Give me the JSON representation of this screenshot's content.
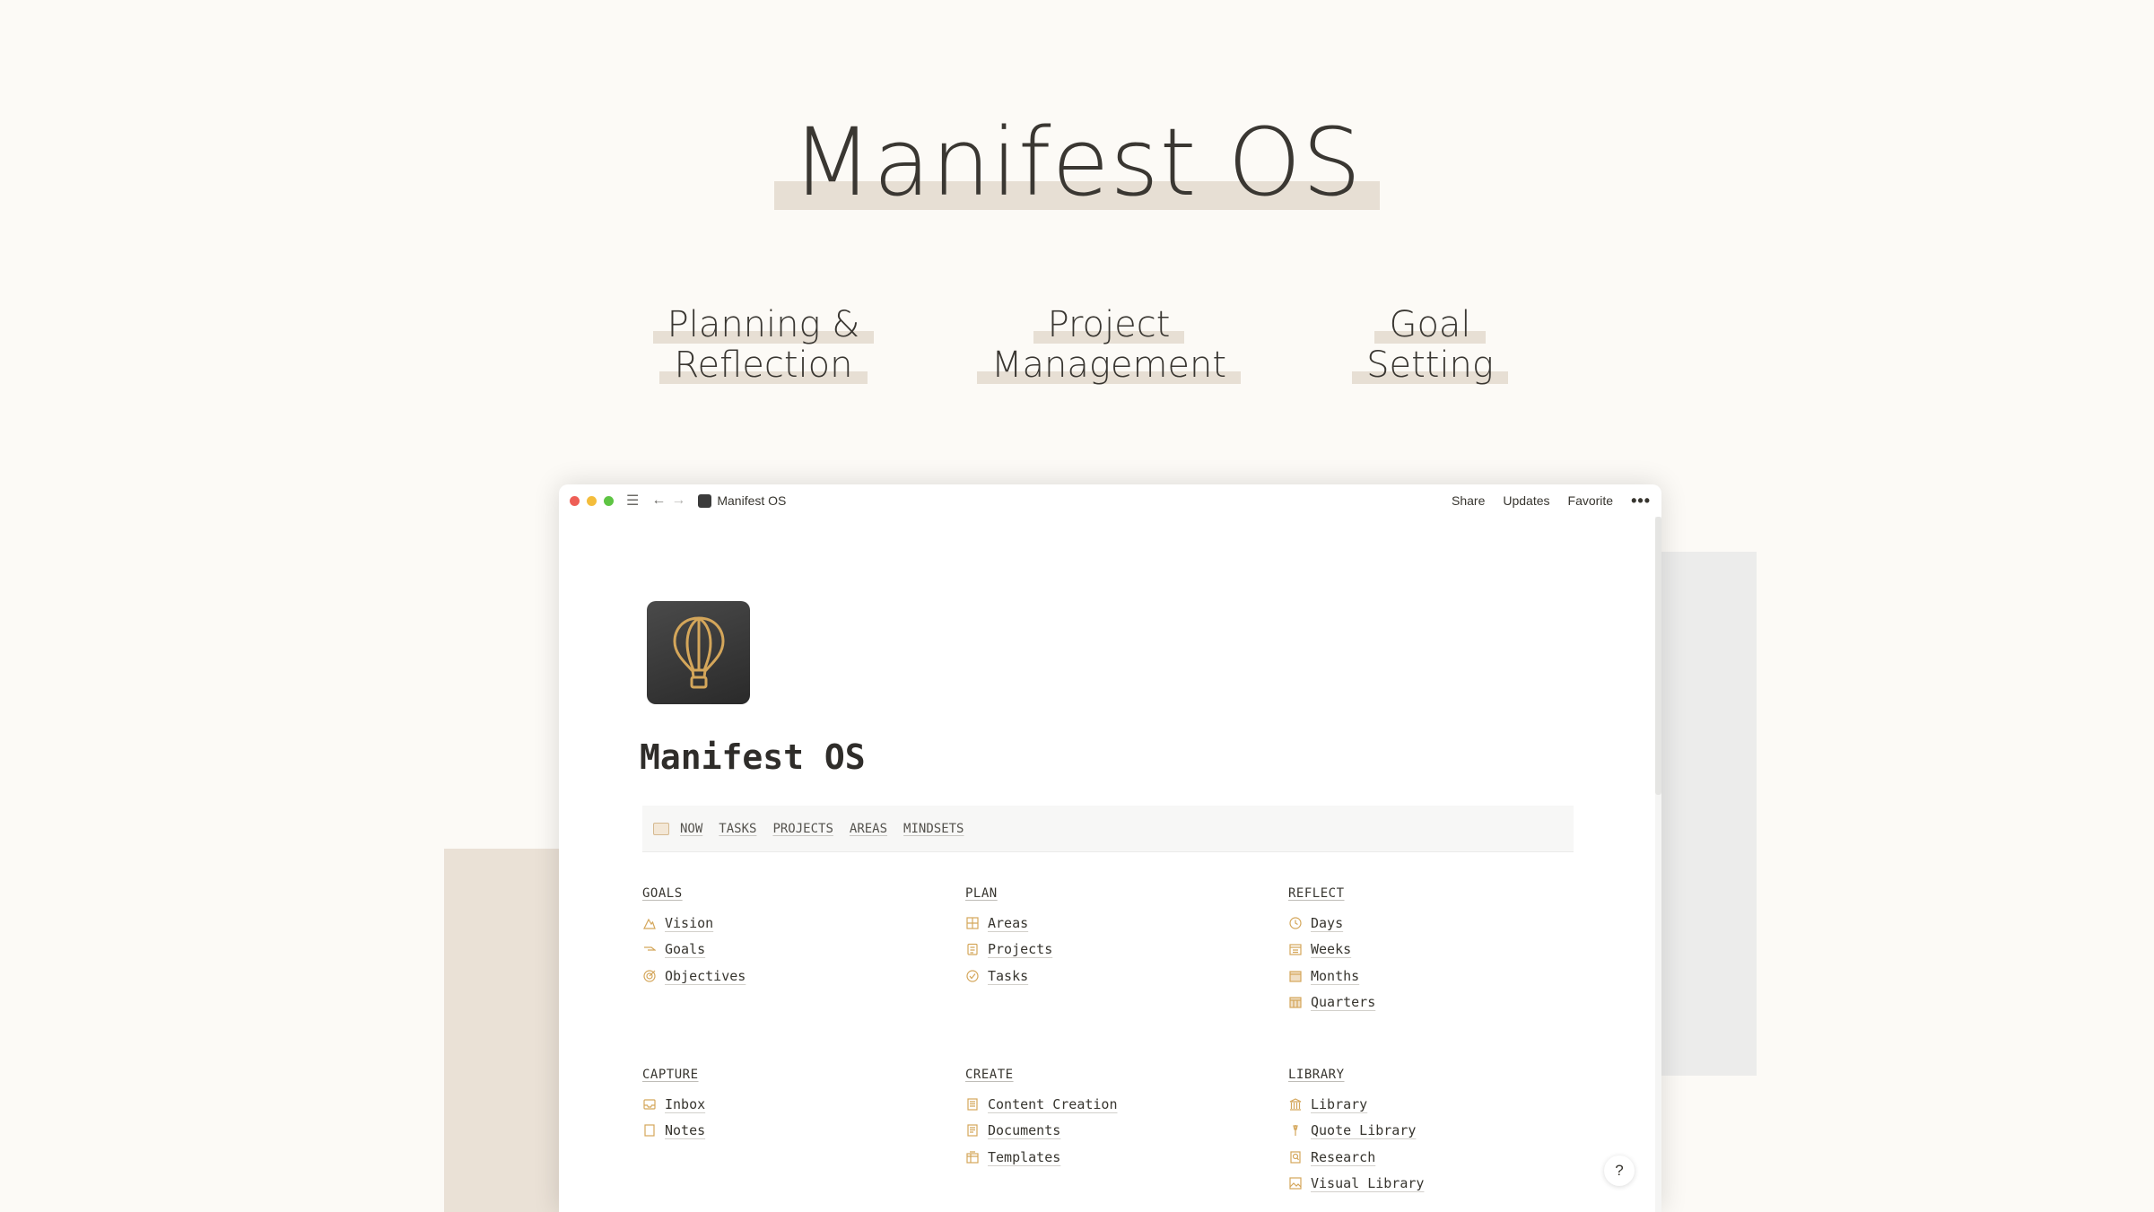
{
  "hero": {
    "title": "Manifest OS",
    "features": [
      {
        "line1": "Planning &",
        "line2": "Reflection"
      },
      {
        "line1": "Project",
        "line2": "Management"
      },
      {
        "line1": "Goal",
        "line2": "Setting"
      }
    ]
  },
  "window": {
    "breadcrumb": "Manifest OS",
    "actions": {
      "share": "Share",
      "updates": "Updates",
      "favorite": "Favorite",
      "more": "•••"
    },
    "page_title": "Manifest OS",
    "help_label": "?",
    "nav": [
      "NOW",
      "TASKS",
      "PROJECTS",
      "AREAS",
      "MINDSETS"
    ],
    "sections": [
      {
        "title": "GOALS",
        "items": [
          {
            "label": "Vision",
            "icon": "mountain-icon"
          },
          {
            "label": "Goals",
            "icon": "flag-icon"
          },
          {
            "label": "Objectives",
            "icon": "target-icon"
          }
        ]
      },
      {
        "title": "PLAN",
        "items": [
          {
            "label": "Areas",
            "icon": "map-icon"
          },
          {
            "label": "Projects",
            "icon": "clipboard-icon"
          },
          {
            "label": "Tasks",
            "icon": "checkmark-icon"
          }
        ]
      },
      {
        "title": "REFLECT",
        "items": [
          {
            "label": "Days",
            "icon": "clock-icon"
          },
          {
            "label": "Weeks",
            "icon": "calendar-icon"
          },
          {
            "label": "Months",
            "icon": "calendar-icon"
          },
          {
            "label": "Quarters",
            "icon": "calendar-icon"
          }
        ]
      },
      {
        "title": "CAPTURE",
        "items": [
          {
            "label": "Inbox",
            "icon": "inbox-icon"
          },
          {
            "label": "Notes",
            "icon": "note-icon"
          }
        ]
      },
      {
        "title": "CREATE",
        "items": [
          {
            "label": "Content Creation",
            "icon": "document-icon"
          },
          {
            "label": "Documents",
            "icon": "document-icon"
          },
          {
            "label": "Templates",
            "icon": "template-icon"
          }
        ]
      },
      {
        "title": "LIBRARY",
        "items": [
          {
            "label": "Library",
            "icon": "library-icon"
          },
          {
            "label": "Quote Library",
            "icon": "quote-icon"
          },
          {
            "label": "Research",
            "icon": "research-icon"
          },
          {
            "label": "Visual Library",
            "icon": "image-icon"
          }
        ]
      }
    ]
  },
  "colors": {
    "accent": "#d4a65a",
    "highlight": "#e7dfd4",
    "background": "#fcfaf6"
  }
}
